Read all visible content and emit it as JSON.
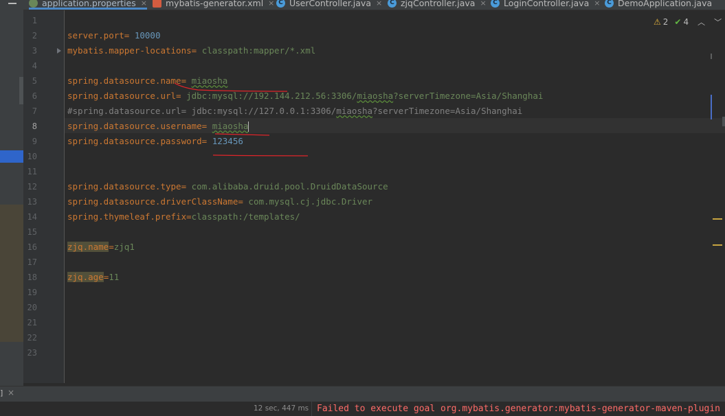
{
  "tabs": [
    {
      "label": "application.properties",
      "icon": "properties-file-icon",
      "active": true
    },
    {
      "label": "mybatis-generator.xml",
      "icon": "xml-file-icon",
      "active": false
    },
    {
      "label": "UserController.java",
      "icon": "java-class-icon",
      "active": false
    },
    {
      "label": "zjqController.java",
      "icon": "java-class-icon",
      "active": false
    },
    {
      "label": "LoginController.java",
      "icon": "java-class-icon",
      "active": false
    },
    {
      "label": "DemoApplication.java",
      "icon": "java-class-icon",
      "active": false
    }
  ],
  "close_glyph": "×",
  "inspections": {
    "warnings": "2",
    "weak_warnings": "4"
  },
  "line_numbers": [
    "1",
    "2",
    "3",
    "4",
    "5",
    "6",
    "7",
    "8",
    "9",
    "10",
    "11",
    "12",
    "13",
    "14",
    "15",
    "16",
    "17",
    "18",
    "19",
    "20",
    "21",
    "22",
    "23"
  ],
  "current_line": "8",
  "code": {
    "l2": {
      "key": "server.port",
      "sep": "= ",
      "value": "10000"
    },
    "l3": {
      "key": "mybatis.mapper-locations",
      "sep": "= ",
      "value": "classpath:mapper/*.xml"
    },
    "l5": {
      "key": "spring.datasource.name",
      "sep": "= ",
      "value": "miaosha"
    },
    "l6": {
      "key": "spring.datasource.url",
      "sep": "= ",
      "value_a": "jdbc:mysql://192.144.212.56:3306/",
      "value_b": "miaosha",
      "value_c": "?serverTimezone=Asia/Shanghai"
    },
    "l7": {
      "comment_a": "#spring.datasource.url= jdbc:mysql://127.0.0.1:3306/",
      "comment_b": "miaosha",
      "comment_c": "?serverTimezone=Asia/Shanghai"
    },
    "l8": {
      "key": "spring.datasource.username",
      "sep": "= ",
      "value": "miaosha"
    },
    "l9": {
      "key": "spring.datasource.password",
      "sep": "= ",
      "value": "123456"
    },
    "l12": {
      "key": "spring.datasource.type",
      "sep": "= ",
      "value": "com.alibaba.druid.pool.DruidDataSource"
    },
    "l13": {
      "key": "spring.datasource.driverClassName",
      "sep": "= ",
      "value": "com.mysql.cj.jdbc.Driver"
    },
    "l14": {
      "key": "spring.thymeleaf.prefix",
      "sep": "=",
      "value": "classpath:/templates/"
    },
    "l16": {
      "key": "zjq.name",
      "sep": "=",
      "value": "zjq1"
    },
    "l18": {
      "key": "zjq.age",
      "sep": "=",
      "value": "11"
    }
  },
  "bottom": {
    "tab_label": "]",
    "elapsed": "12 sec, 447 ms",
    "error": "Failed to execute goal org.mybatis.generator:mybatis-generator-maven-plugin"
  },
  "colors": {
    "key": "#cc7832",
    "value": "#6a8759",
    "number": "#6897bb",
    "comment": "#808080",
    "annotation": "#e0252a",
    "error": "#ff6b68"
  }
}
